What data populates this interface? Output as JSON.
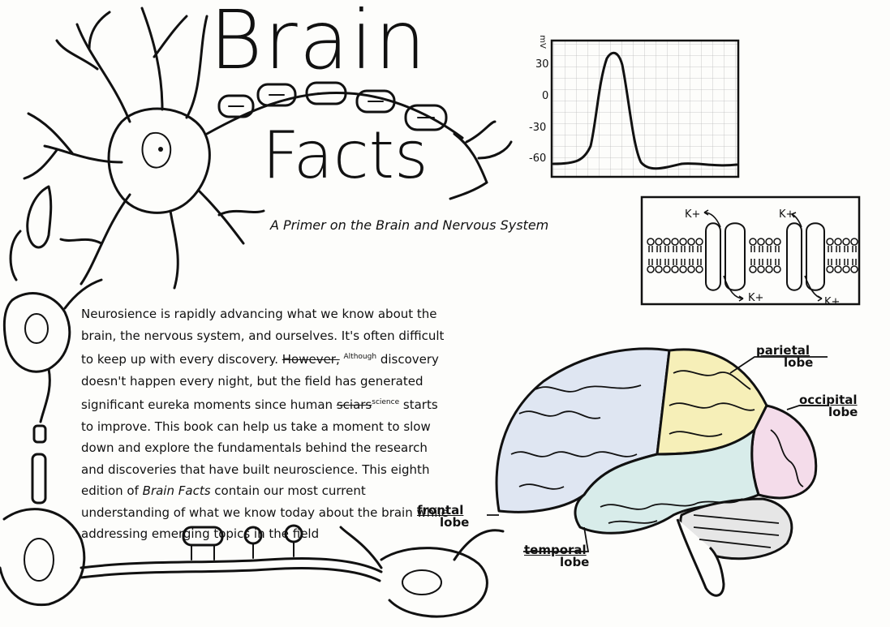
{
  "title_line1": "Brain",
  "title_line2": "Facts",
  "subtitle": "A Primer on the Brain and Nervous System",
  "paragraph": {
    "p1": "Neurosience is rapidly advancing what we know about the brain, the nervous system, and ourselves. It's often difficult to keep up with every discovery. ",
    "struck1": "However,",
    "insert1": "Although",
    "p2": " discovery doesn't happen every night, but the field has generated significant eureka moments since human ",
    "struck2": "sciars",
    "insert2": "science",
    "p3": " starts to improve. This book can help us take a moment to slow down and explore the fundamentals behind the research and discoveries that have built neuroscience. This eighth edition of ",
    "book_title": "Brain Facts",
    "p4": " contain our most current understanding of what we know today about the brain while addressing emerging topics in the field"
  },
  "graph": {
    "unit": "mV",
    "ticks": [
      "30",
      "0",
      "-30",
      "-60"
    ]
  },
  "channels": {
    "ion_label": "K+"
  },
  "brain_labels": {
    "parietal": [
      "parietal",
      "lobe"
    ],
    "occipital": [
      "occipital",
      "lobe"
    ],
    "frontal": [
      "frontal",
      "lobe"
    ],
    "temporal": [
      "temporal",
      "lobe"
    ]
  },
  "colors": {
    "frontal": "#dfe6f2",
    "parietal": "#f6efb8",
    "occipital": "#f4dcea",
    "temporal": "#d8ecea",
    "cerebellum": "#e6e6e6"
  }
}
